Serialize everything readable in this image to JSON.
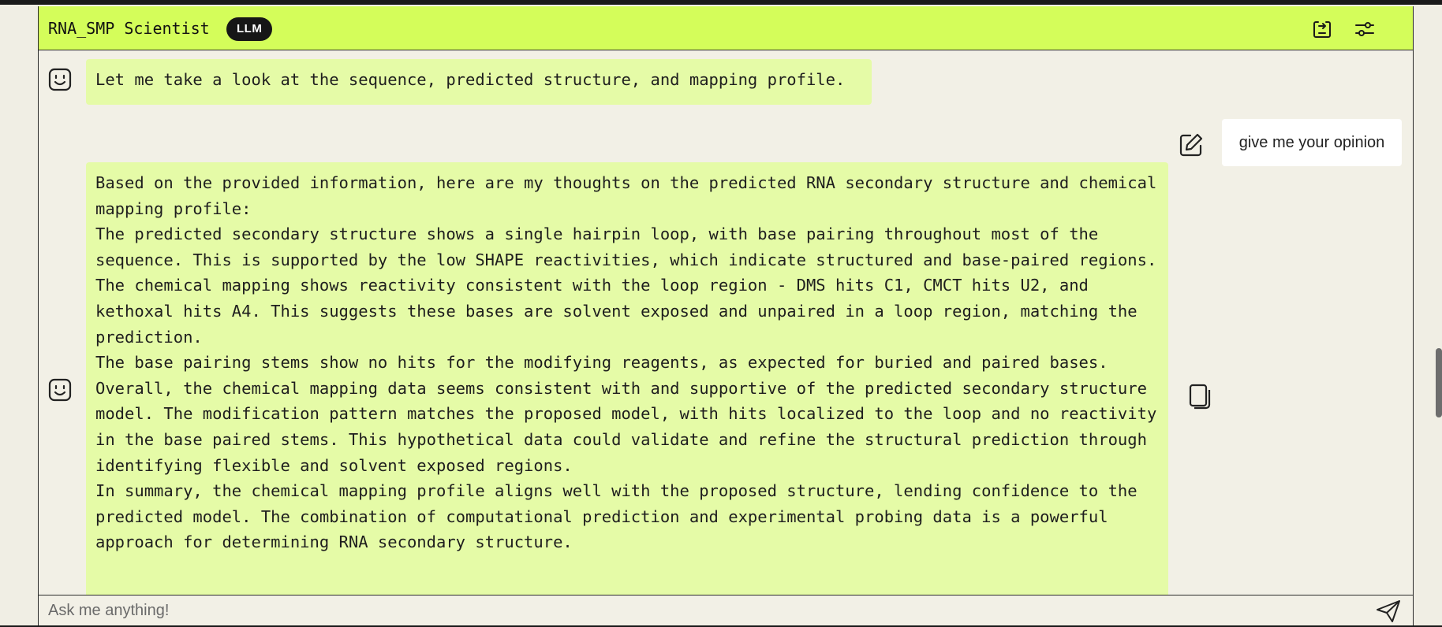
{
  "header": {
    "title": "RNA_SMP Scientist",
    "badge": "LLM",
    "export_icon": "export-chat-icon",
    "settings_icon": "settings-sliders-icon"
  },
  "messages": [
    {
      "role": "assistant",
      "avatar_icon": "smiley-bot-icon",
      "text": "Let me take a look at the sequence, predicted structure, and mapping profile."
    },
    {
      "role": "user",
      "edit_icon": "edit-pencil-icon",
      "text": "give me your opinion"
    },
    {
      "role": "assistant",
      "avatar_icon": "smiley-bot-icon",
      "copy_icon": "copy-icon",
      "paragraphs": [
        "Based on the provided information, here are my thoughts on the predicted RNA secondary structure and chemical mapping profile:",
        "The predicted secondary structure shows a single hairpin loop, with base pairing throughout most of the sequence. This is supported by the low SHAPE reactivities, which indicate structured and base-paired regions.",
        "The chemical mapping shows reactivity consistent with the loop region - DMS hits C1, CMCT hits U2, and kethoxal hits A4. This suggests these bases are solvent exposed and unpaired in a loop region, matching the prediction.",
        "The base pairing stems show no hits for the modifying reagents, as expected for buried and paired bases.",
        "Overall, the chemical mapping data seems consistent with and supportive of the predicted secondary structure model. The modification pattern matches the proposed model, with hits localized to the loop and no reactivity in the base paired stems. This hypothetical data could validate and refine the structural prediction through identifying flexible and solvent exposed regions.",
        "In summary, the chemical mapping profile aligns well with the proposed structure, lending confidence to the predicted model. The combination of computational prediction and experimental probing data is a powerful approach for determining RNA secondary structure."
      ]
    }
  ],
  "input": {
    "placeholder": "Ask me anything!",
    "value": "",
    "send_icon": "send-paper-plane-icon"
  },
  "colors": {
    "header_bg": "#d4fd5a",
    "assistant_bubble": "#e5fba7",
    "user_bubble": "#ffffff",
    "page_bg": "#f2f0e6",
    "badge_bg": "#161616"
  }
}
